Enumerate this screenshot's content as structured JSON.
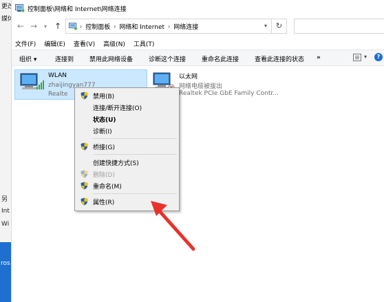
{
  "background": {
    "labels": [
      "更改",
      "媒体",
      "另",
      "Int",
      "Wi"
    ],
    "taskbar_text": "ros"
  },
  "window": {
    "title": "控制面板\\网络和 Internet\\网络连接"
  },
  "nav": {
    "back_icon": "arrow-left-icon",
    "forward_icon": "arrow-right-icon",
    "recent_icon": "chevron-down-icon",
    "up_icon": "arrow-up-icon"
  },
  "address": {
    "crumbs": [
      "控制面板",
      "网络和 Internet",
      "网络连接"
    ],
    "search_placeholder": ""
  },
  "menubar": [
    "文件(F)",
    "编辑(E)",
    "查看(V)",
    "高级(N)",
    "工具(T)"
  ],
  "commands": {
    "organize": "组织 ▾",
    "connect_to": "连接到",
    "disable": "禁用此网络设备",
    "diagnose": "诊断这个连接",
    "rename": "重命名此连接",
    "view_status": "查看此连接的状态",
    "more": "»"
  },
  "connections": [
    {
      "name": "WLAN",
      "network": "zhaijingyan777",
      "device": "Realte"
    },
    {
      "name": "以太网",
      "network": "网络电缆被拔出",
      "device": "Realtek PCIe GbE Family Contr..."
    }
  ],
  "context_menu": [
    {
      "label": "禁用(B)",
      "shield": true,
      "bold": false,
      "disabled": false
    },
    {
      "label": "连接/断开连接(O)",
      "shield": false,
      "bold": false,
      "disabled": false
    },
    {
      "label": "状态(U)",
      "shield": false,
      "bold": true,
      "disabled": false
    },
    {
      "label": "诊断(I)",
      "shield": false,
      "bold": false,
      "disabled": false
    },
    {
      "label": "桥接(G)",
      "shield": true,
      "bold": false,
      "disabled": false
    },
    {
      "label": "创建快捷方式(S)",
      "shield": false,
      "bold": false,
      "disabled": false
    },
    {
      "label": "删除(D)",
      "shield": true,
      "bold": false,
      "disabled": true
    },
    {
      "label": "重命名(M)",
      "shield": true,
      "bold": false,
      "disabled": false
    },
    {
      "label": "属性(R)",
      "shield": true,
      "bold": false,
      "disabled": false
    }
  ],
  "colors": {
    "selection": "#cce8ff",
    "arrow": "#e8322a",
    "shield_blue": "#1f5fbf",
    "shield_yellow": "#f2c200"
  }
}
